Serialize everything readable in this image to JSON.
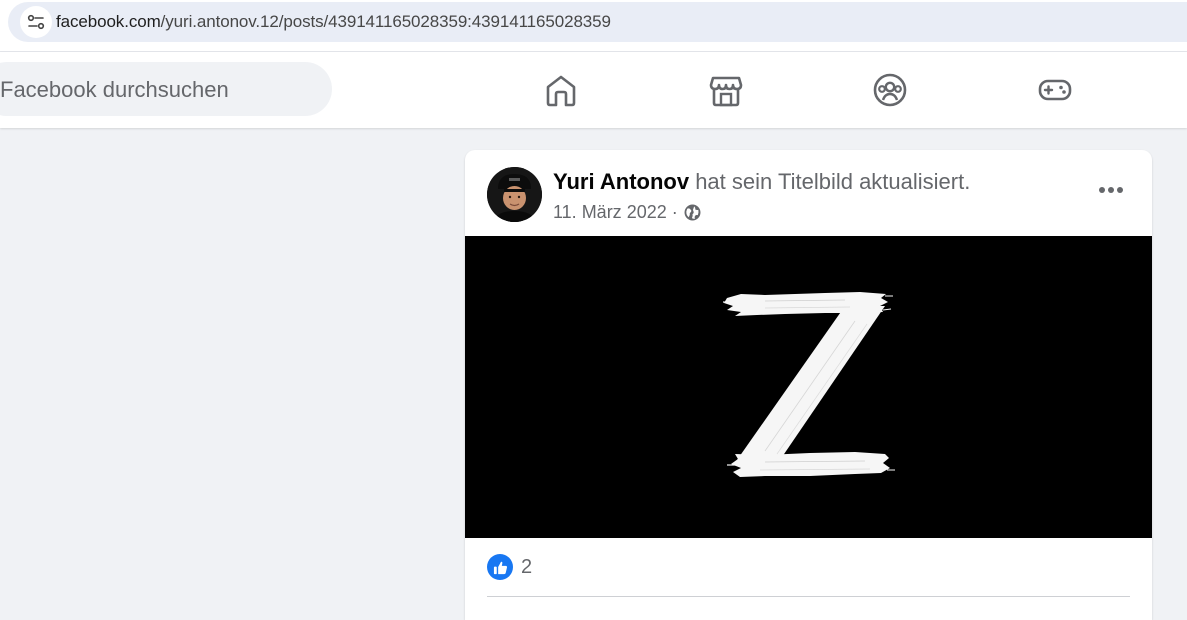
{
  "browser": {
    "url_domain": "facebook.com",
    "url_path": "/yuri.antonov.12/posts/439141165028359:439141165028359",
    "site_info_icon": "tune-icon"
  },
  "header": {
    "search_placeholder": "Facebook durchsuchen",
    "nav_icons": [
      "home-icon",
      "marketplace-icon",
      "groups-icon",
      "gaming-icon"
    ]
  },
  "post": {
    "author": "Yuri Antonov",
    "action": " hat sein Titelbild aktualisiert.",
    "date": "11. März 2022",
    "separator": " · ",
    "audience_icon": "globe-icon",
    "more_icon": "more-options-icon",
    "cover_glyph": "Z",
    "reaction_icon": "like-icon",
    "reaction_count": "2"
  },
  "colors": {
    "accent": "#1877f2",
    "page_bg": "#f0f2f5",
    "url_bar_bg": "#e9edf6",
    "cover_bg": "#000000"
  }
}
